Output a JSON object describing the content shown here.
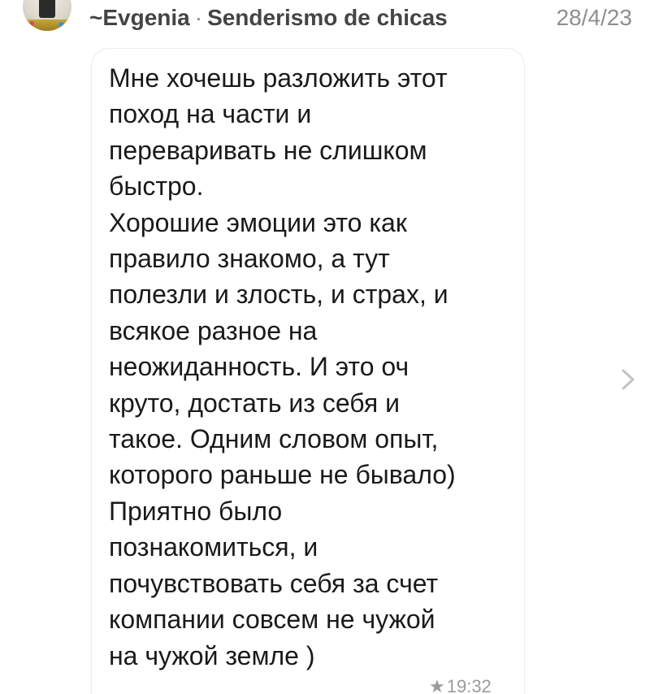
{
  "header": {
    "author": "~Evgenia",
    "separator": "·",
    "group": "Senderismo de chicas",
    "date": "28/4/23"
  },
  "message": {
    "lines": [
      "Мне хочешь разложить этот",
      "поход на части и",
      "переваривать не слишком",
      "быстро.",
      "Хорошие эмоции это как",
      "правило знакомо, а тут",
      "полезли и злость, и страх, и",
      "всякое разное на",
      "неожиданность. И это оч",
      "круто, достать из себя и",
      "такое. Одним словом опыт,",
      "которого раньше не бывало)",
      "Приятно было",
      "познакомиться, и",
      "почувствовать себя за счет",
      "компании совсем не чужой",
      "на чужой земле )"
    ],
    "starred_icon": "★",
    "time": "19:32"
  },
  "icons": {
    "avatar": "avatar-photo",
    "star": "star-icon",
    "chevron": "chevron-right-icon"
  }
}
